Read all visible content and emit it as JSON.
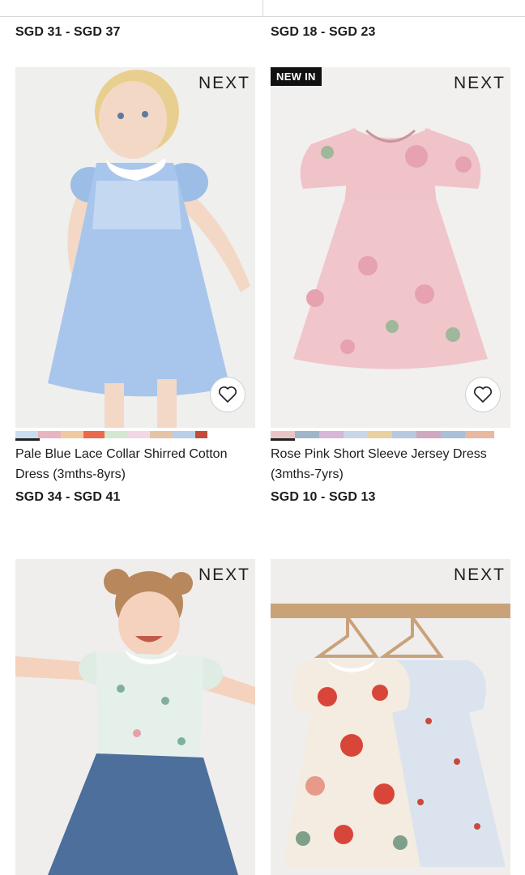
{
  "top_row": {
    "left_price": "SGD 31 - SGD 37",
    "right_price": "SGD 18 - SGD 23"
  },
  "products": [
    {
      "brand": "NEXT",
      "title": "Pale Blue Lace Collar Shirred Cotton Dress (3mths-8yrs)",
      "price": "SGD 34 - SGD 41",
      "badge": "",
      "swatches": [
        "#c9dcf0",
        "#e8b4c0",
        "#f0c9a0",
        "#d4e8d0",
        "#f2d7e4",
        "#e6c3a6",
        "#b9cfe8",
        "#f5e0a8",
        "#e4a0a8"
      ]
    },
    {
      "brand": "NEXT",
      "title": "Rose Pink Short Sleeve Jersey Dress (3mths-7yrs)",
      "price": "SGD 10 - SGD 13",
      "badge": "NEW IN",
      "swatches": [
        "#e9c4c6",
        "#9fb6c9",
        "#d8b6d8",
        "#c8d6e8",
        "#e8d0a0",
        "#b8c8e0",
        "#d0a8c0",
        "#a8c0d8",
        "#e8b8a0"
      ]
    },
    {
      "brand": "NEXT",
      "title": "",
      "price": "",
      "badge": ""
    },
    {
      "brand": "NEXT",
      "title": "",
      "price": "",
      "badge": ""
    }
  ],
  "colors": {
    "text": "#1c1c1c",
    "badge_bg": "#111111",
    "divider": "#d6d6d6"
  }
}
